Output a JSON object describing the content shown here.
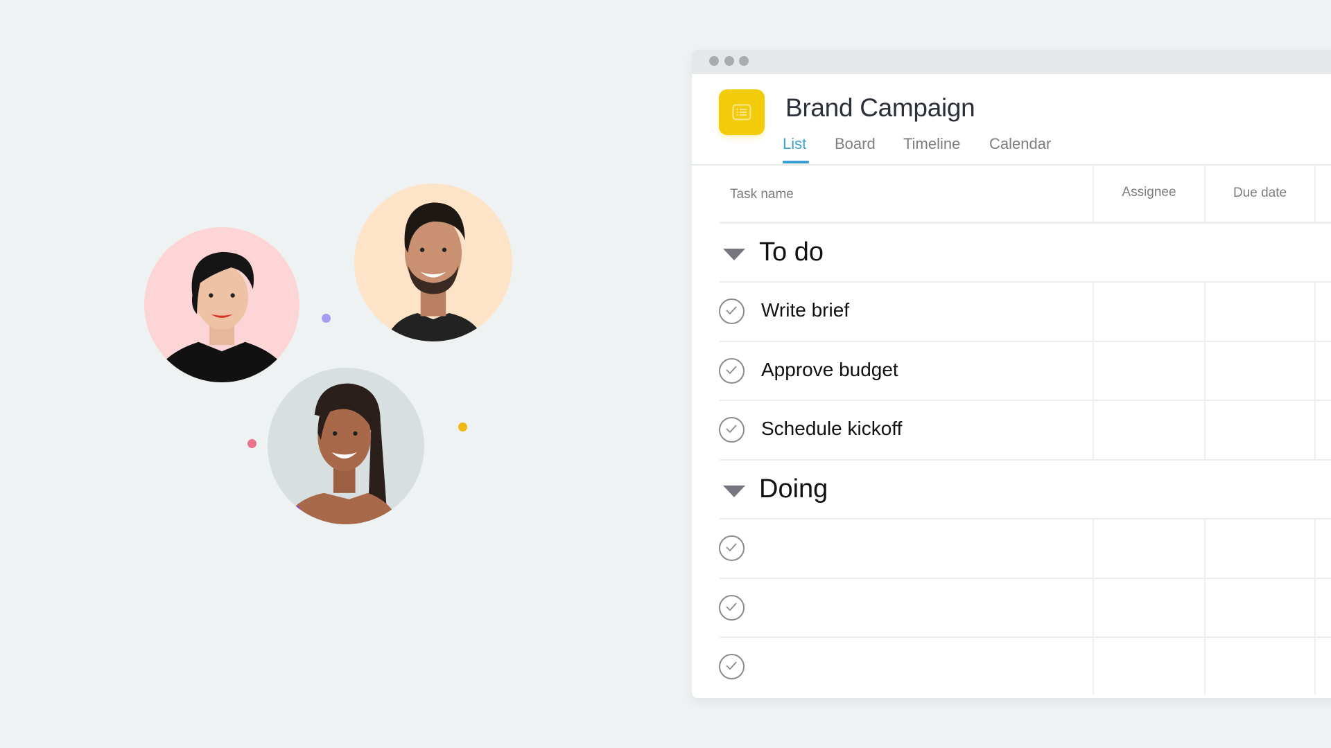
{
  "people": [
    {
      "name": "avatar-woman-short-hair",
      "bg": "#fdd5d6",
      "skin": "#eec3a5",
      "hair": "#151515",
      "shirt": "#111111"
    },
    {
      "name": "avatar-man-beard",
      "bg": "#fde4c8",
      "skin": "#c99172",
      "hair": "#1e1815",
      "shirt": "#222222"
    },
    {
      "name": "avatar-woman-long-hair",
      "bg": "#d8dfe1",
      "skin": "#a8694a",
      "hair": "#2a1f1b",
      "shirt": "#8a46e0"
    }
  ],
  "dots": [
    {
      "name": "purple-dot",
      "color": "#a79cf0"
    },
    {
      "name": "pink-dot",
      "color": "#e8748a"
    },
    {
      "name": "yellow-dot",
      "color": "#f0b814"
    }
  ],
  "window": {
    "project": {
      "title": "Brand Campaign",
      "icon": "list-icon",
      "icon_color": "#f2cb0a"
    },
    "tabs": [
      {
        "label": "List",
        "active": true
      },
      {
        "label": "Board",
        "active": false
      },
      {
        "label": "Timeline",
        "active": false
      },
      {
        "label": "Calendar",
        "active": false
      }
    ],
    "columns": [
      "Task name",
      "Assignee",
      "Due date"
    ],
    "sections": [
      {
        "title": "To do",
        "tasks": [
          {
            "name": "Write brief"
          },
          {
            "name": "Approve budget"
          },
          {
            "name": "Schedule kickoff"
          }
        ]
      },
      {
        "title": "Doing",
        "tasks": [
          {
            "name": ""
          },
          {
            "name": ""
          },
          {
            "name": ""
          }
        ]
      }
    ]
  }
}
